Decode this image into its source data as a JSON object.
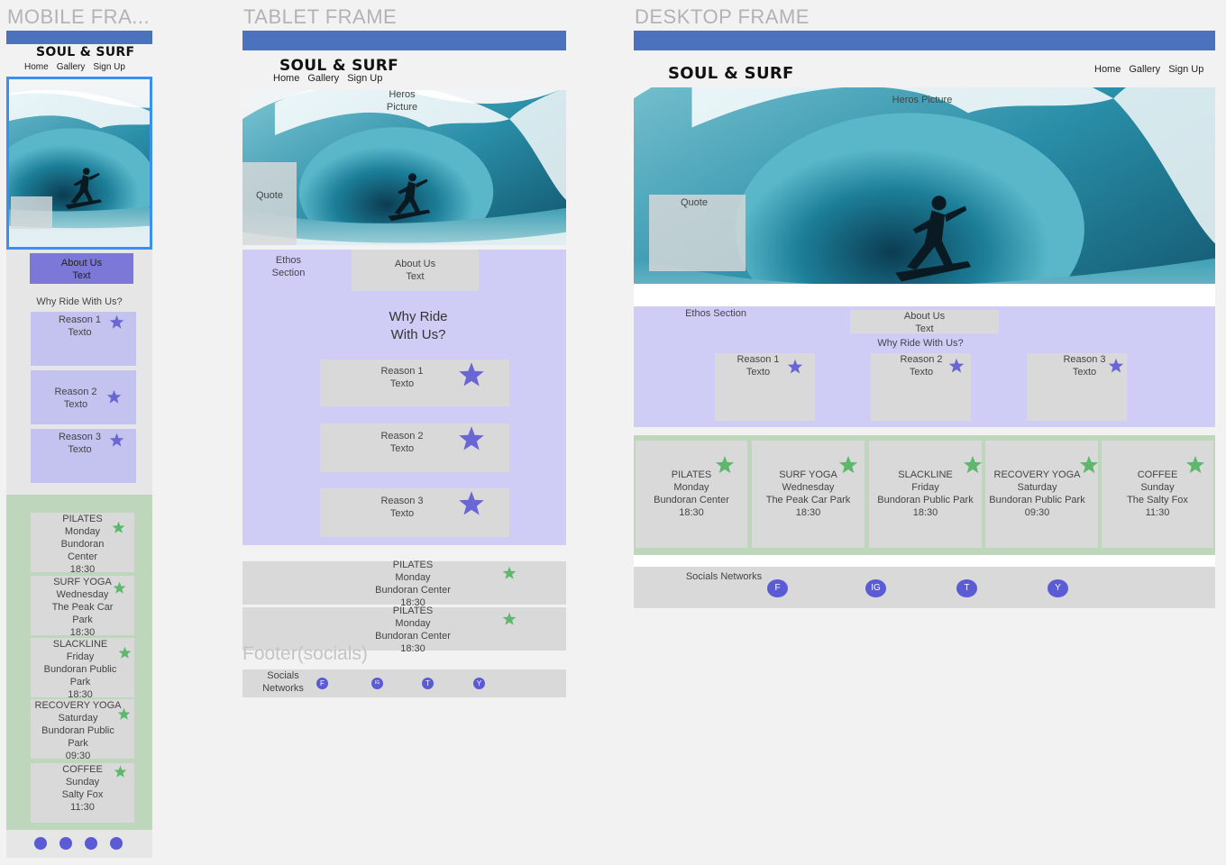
{
  "frames": {
    "mobile_label": "MOBILE FRA...",
    "tablet_label": "TABLET FRAME",
    "desktop_label": "DESKTOP FRAME"
  },
  "brand": "SOUL & SURF",
  "nav": {
    "home": "Home",
    "gallery": "Gallery",
    "signup": "Sign Up"
  },
  "hero": {
    "label_desktop": "Heros Picture",
    "label_tablet_1": "Heros",
    "label_tablet_2": "Picture",
    "quote": "Quote"
  },
  "ethos": {
    "desktop": "Ethos Section",
    "tablet_1": "Ethos",
    "tablet_2": "Section"
  },
  "about": {
    "line1": "About Us",
    "line2": "Text"
  },
  "why": {
    "single": "Why Ride With Us?",
    "tablet_1": "Why Ride",
    "tablet_2": "With Us?"
  },
  "reasons": [
    {
      "title": "Reason 1",
      "text": "Texto"
    },
    {
      "title": "Reason 2",
      "text": "Texto"
    },
    {
      "title": "Reason 3",
      "text": "Texto"
    }
  ],
  "classes": [
    {
      "name": "PILATES",
      "day": "Monday",
      "place": "Bundoran Center",
      "place_mobile_1": "Bundoran",
      "place_mobile_2": "Center",
      "time": "18:30"
    },
    {
      "name": "SURF YOGA",
      "day": "Wednesday",
      "place": "The Peak Car Park",
      "place_mobile_1": "The Peak Car",
      "place_mobile_2": "Park",
      "time": "18:30"
    },
    {
      "name": "SLACKLINE",
      "day": "Friday",
      "place": "Bundoran Public Park",
      "place_mobile_1": "Bundoran Public",
      "place_mobile_2": "Park",
      "time": "18:30"
    },
    {
      "name": "RECOVERY YOGA",
      "day": "Saturday",
      "place": "Bundoran Public Park",
      "place_mobile_1": "Bundoran Public",
      "place_mobile_2": "Park",
      "time": "09:30"
    },
    {
      "name": "COFFEE",
      "day": "Sunday",
      "place": "The Salty Fox",
      "place_mobile_1": "Salty Fox",
      "place_mobile_2": "",
      "time": "11:30"
    }
  ],
  "footer": {
    "overlay_label": "Footer(socials)",
    "socials_desktop": "Socials Networks",
    "socials_tablet_1": "Socials",
    "socials_tablet_2": "Networks",
    "icons": [
      "F",
      "IG",
      "T",
      "Y"
    ]
  },
  "colors": {
    "bar": "#4a72bd",
    "lavender": "#cfcdf6",
    "gray": "#d9d9d9",
    "green": "#bed7bc",
    "star_purple": "#6a66d4",
    "star_green": "#5fb76d",
    "selection": "#3b8ff0"
  }
}
